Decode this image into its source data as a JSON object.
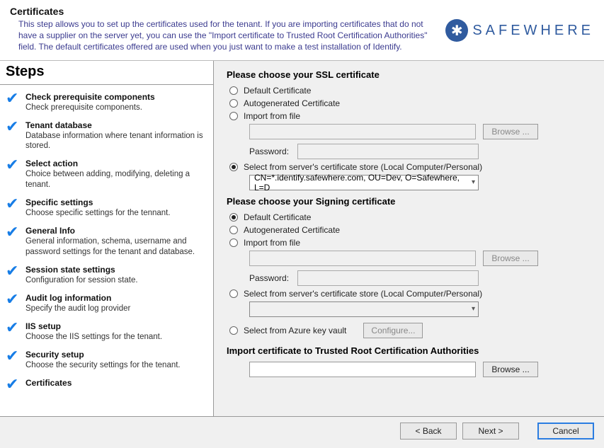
{
  "header": {
    "title": "Certificates",
    "description": "This step allows you to set up the certificates used for the tenant. If you are importing certificates that do not have a supplier on the server yet, you can use the \"Import certificate to Trusted Root Certification Authorities\" field. The default certificates offered are used when you just want to make a test installation of Identify."
  },
  "logo": {
    "icon_glyph": "✱",
    "text": "SAFEWHERE"
  },
  "sidebar": {
    "title": "Steps",
    "steps": [
      {
        "title": "Check prerequisite components",
        "desc": "Check prerequisite components."
      },
      {
        "title": "Tenant database",
        "desc": "Database information where tenant information is stored."
      },
      {
        "title": "Select action",
        "desc": "Choice between adding, modifying, deleting a tenant."
      },
      {
        "title": "Specific settings",
        "desc": "Choose specific settings for the tennant."
      },
      {
        "title": "General Info",
        "desc": "General information, schema, username and password settings for the tenant and database."
      },
      {
        "title": "Session state settings",
        "desc": "Configuration for session state."
      },
      {
        "title": "Audit log information",
        "desc": "Specify the audit log provider"
      },
      {
        "title": "IIS setup",
        "desc": "Choose the IIS settings for the tenant."
      },
      {
        "title": "Security setup",
        "desc": "Choose the security settings for the tenant."
      },
      {
        "title": "Certificates",
        "desc": ""
      }
    ]
  },
  "main": {
    "ssl": {
      "title": "Please choose your SSL certificate",
      "options": {
        "default": "Default Certificate",
        "autogen": "Autogenerated Certificate",
        "import": "Import from file",
        "store": "Select from server's certificate store (Local Computer/Personal)"
      },
      "password_label": "Password:",
      "browse_label": "Browse ...",
      "store_value": "CN=*.identify.safewhere.com, OU=Dev, O=Safewhere, L=D"
    },
    "signing": {
      "title": "Please choose your Signing certificate",
      "options": {
        "default": "Default Certificate",
        "autogen": "Autogenerated Certificate",
        "import": "Import from file",
        "store": "Select from server's certificate store (Local Computer/Personal)",
        "azure": "Select from Azure key vault"
      },
      "password_label": "Password:",
      "browse_label": "Browse ...",
      "configure_label": "Configure..."
    },
    "trca": {
      "title": "Import certificate to Trusted Root Certification Authorities",
      "browse_label": "Browse ..."
    }
  },
  "footer": {
    "back": "< Back",
    "next": "Next >",
    "cancel": "Cancel"
  }
}
